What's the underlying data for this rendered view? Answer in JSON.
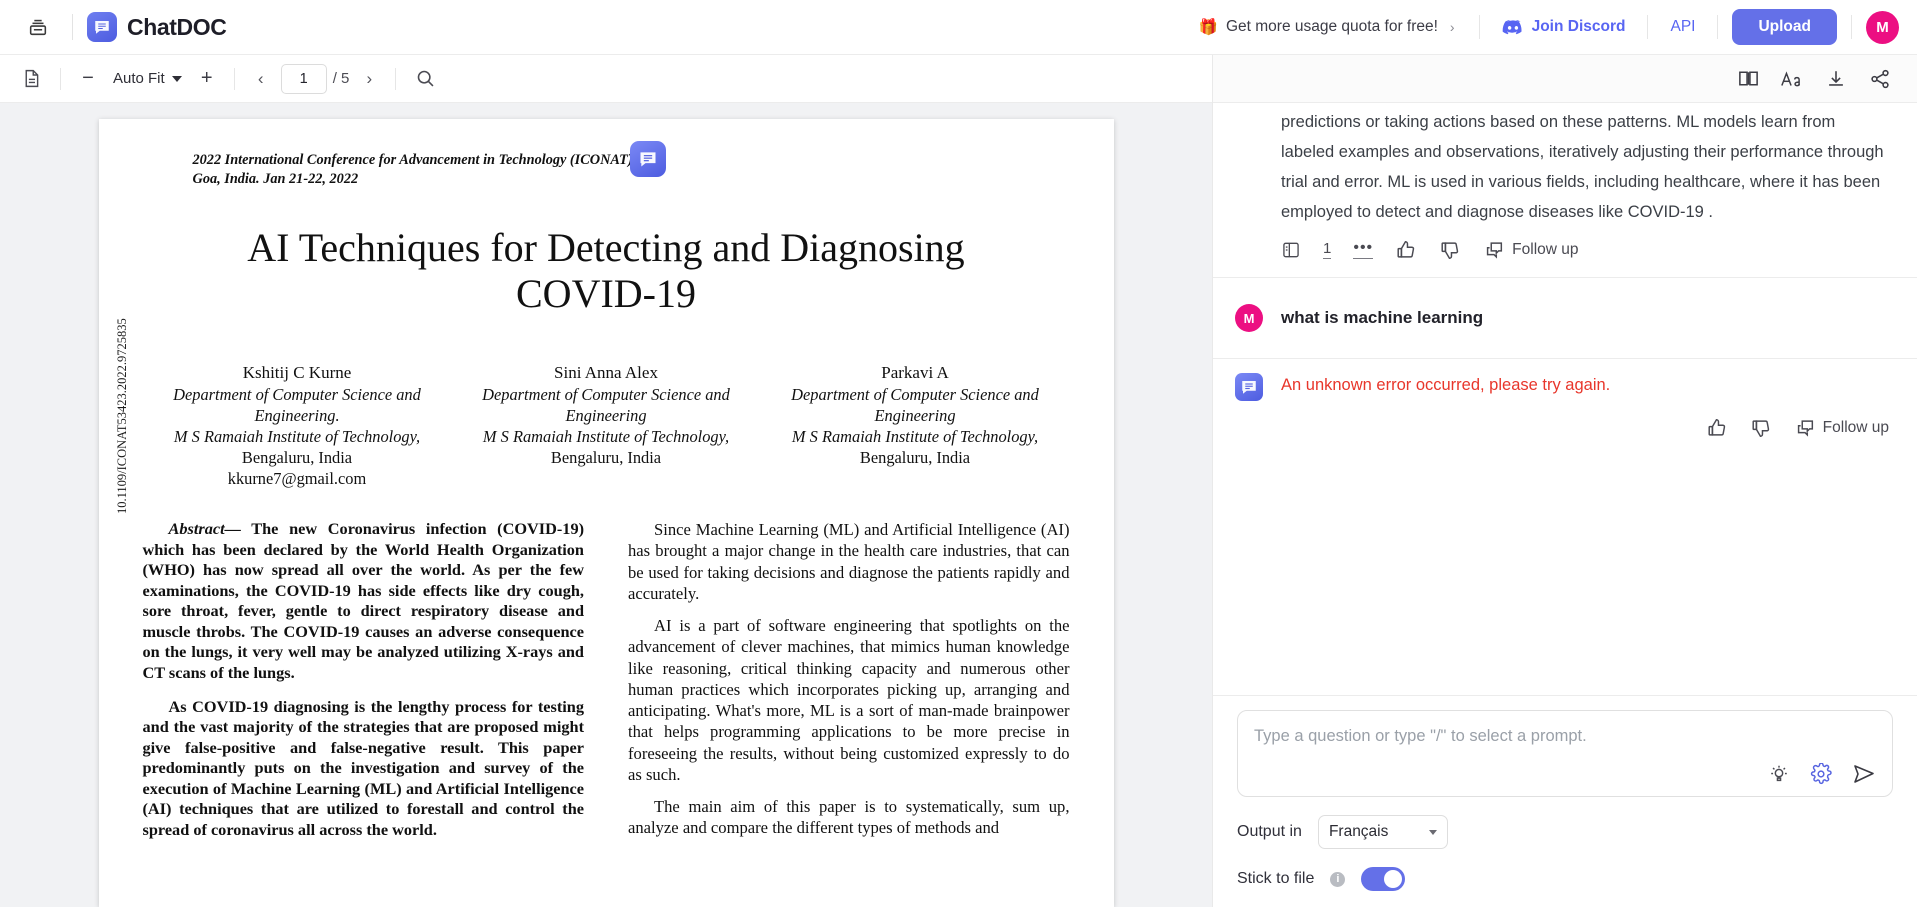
{
  "header": {
    "sidebar_toggle_icon": "library-icon",
    "brand_name": "ChatDOC",
    "brand_logo_icon": "chatdoc-logo-icon",
    "quota_label": "Get more usage quota for free!",
    "quota_gift_icon": "gift-icon",
    "quota_chevron": "›",
    "discord_label": "Join Discord",
    "discord_icon": "discord-icon",
    "api_label": "API",
    "upload_label": "Upload",
    "avatar_initial": "M",
    "avatar_color": "#ec0f82",
    "upload_color": "#6470e8",
    "link_color": "#5865F2"
  },
  "pdf_toolbar": {
    "thumbnail_icon": "document-outline-icon",
    "zoom_out": "−",
    "zoom_level": "Auto Fit",
    "zoom_in": "+",
    "prev_page_icon": "chevron-left-icon",
    "page_number": "1",
    "page_total": "/ 5",
    "next_page_icon": "chevron-right-icon",
    "search_icon": "search-icon"
  },
  "document": {
    "doi": "10.1109/ICONAT53423.2022.9725835",
    "conference_line1": "2022 International Conference for Advancement in Technology (ICONAT)",
    "conference_line2": "Goa, India. Jan 21-22, 2022",
    "badge_icon": "chatdoc-highlight-icon",
    "title": "AI Techniques for Detecting and Diagnosing COVID-19",
    "authors": [
      {
        "name": "Kshitij C Kurne",
        "dept": "Department of Computer Science and Engineering.",
        "institute": "M S Ramaiah Institute of Technology,",
        "city": "Bengaluru, India",
        "email": "kkurne7@gmail.com"
      },
      {
        "name": "Sini Anna Alex",
        "dept": "Department of Computer Science and Engineering",
        "institute": "M S Ramaiah Institute of Technology,",
        "city": "Bengaluru, India",
        "email": ""
      },
      {
        "name": "Parkavi A",
        "dept": "Department of Computer Science and Engineering",
        "institute": "M S Ramaiah Institute of Technology,",
        "city": "Bengaluru, India",
        "email": ""
      }
    ],
    "abstract_label": "Abstract—",
    "abstract_p1": "The new Coronavirus infection (COVID-19) which has been declared by the World Health Organization (WHO) has now spread all over the world. As per the few examinations, the COVID-19 has side effects like dry cough, sore throat, fever, gentle to direct respiratory disease and muscle throbs. The COVID-19 causes an adverse consequence on the lungs, it very well may be analyzed utilizing X-rays and CT scans of the lungs.",
    "abstract_p2": "As COVID-19 diagnosing is the lengthy process for testing and the vast majority of the strategies that are proposed might give false-positive and false-negative result. This paper predominantly puts on the investigation and survey of the execution of Machine Learning (ML) and Artificial Intelligence (AI) techniques that are utilized to forestall and control the spread of coronavirus all across the world.",
    "right_p1": "Since Machine Learning (ML) and Artificial Intelligence (AI) has brought a major change in the health care industries, that can be used for taking decisions and diagnose the patients rapidly and accurately.",
    "right_p2": "AI is a part of software engineering that spotlights on the advancement of clever machines, that mimics human knowledge like reasoning, critical thinking capacity and numerous other human practices which incorporates picking up, arranging and anticipating. What's more, ML is a sort of man-made brainpower that helps programming applications to be more precise in foreseeing the results, without being customized expressly to do as such.",
    "right_p3": "The main aim of this paper is to systematically, sum up, analyze and compare the different types of methods and"
  },
  "chat": {
    "toolbar": {
      "book_icon": "book-open-icon",
      "font_icon": "font-size-icon",
      "download_icon": "download-icon",
      "share_icon": "share-icon"
    },
    "answer": {
      "text": "predictions or taking actions based on these patterns. ML models learn from labeled examples and observations, iteratively adjusting their performance through trial and error. ML is used in various fields, including healthcare, where it has been employed to detect and diagnose diseases like COVID-19 .",
      "actions": {
        "source_panel_icon": "source-panel-icon",
        "citation_count": "1",
        "more_icon": "•••",
        "thumbs_up_icon": "thumbs-up-icon",
        "thumbs_down_icon": "thumbs-down-icon",
        "follow_up_icon": "follow-up-icon",
        "follow_up_label": "Follow up"
      }
    },
    "user_message": {
      "avatar_initial": "M",
      "text": "what is machine learning"
    },
    "error_message": {
      "bot_icon": "chatdoc-bot-icon",
      "text": "An unknown error occurred, please try again.",
      "error_color": "#e8362b",
      "thumbs_up_icon": "thumbs-up-icon",
      "thumbs_down_icon": "thumbs-down-icon",
      "follow_up_icon": "follow-up-icon",
      "follow_up_label": "Follow up"
    },
    "composer": {
      "placeholder": "Type a question or type \"/\" to select a prompt.",
      "bulb_icon": "lightbulb-icon",
      "settings_icon": "gear-icon",
      "send_icon": "send-icon",
      "output_label": "Output in",
      "output_value": "Français",
      "stick_label": "Stick to file",
      "stick_info_icon": "info-icon",
      "stick_enabled": true,
      "toggle_color": "#6470e8"
    }
  }
}
